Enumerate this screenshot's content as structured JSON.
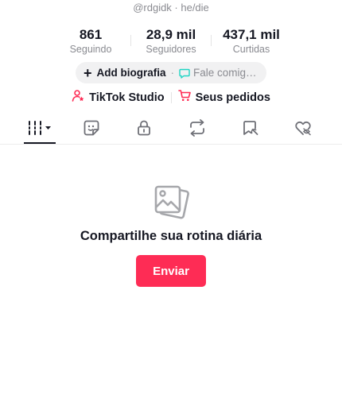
{
  "profile": {
    "handle": "@rdgidk · he/die",
    "stats": [
      {
        "value": "861",
        "label": "Seguindo"
      },
      {
        "value": "28,9 mil",
        "label": "Seguidores"
      },
      {
        "value": "437,1 mil",
        "label": "Curtidas"
      }
    ],
    "bio": {
      "add_label": "Add biografia",
      "separator": "·",
      "message_label": "Fale comigo..."
    },
    "links": {
      "studio_label": "TikTok Studio",
      "orders_label": "Seus pedidos"
    }
  },
  "tabs": [
    {
      "icon": "video-grid-icon",
      "active": true
    },
    {
      "icon": "sticker-icon",
      "active": false
    },
    {
      "icon": "lock-icon",
      "active": false
    },
    {
      "icon": "repost-icon",
      "active": false
    },
    {
      "icon": "bookmark-icon",
      "active": false
    },
    {
      "icon": "heart-eye-off-icon",
      "active": false
    }
  ],
  "empty_state": {
    "icon": "photos-icon",
    "title": "Compartilhe sua rotina diária",
    "button_label": "Enviar"
  },
  "colors": {
    "accent": "#fe2c55",
    "teal": "#20d5c4",
    "text": "#161823",
    "muted": "#8a8b91"
  }
}
